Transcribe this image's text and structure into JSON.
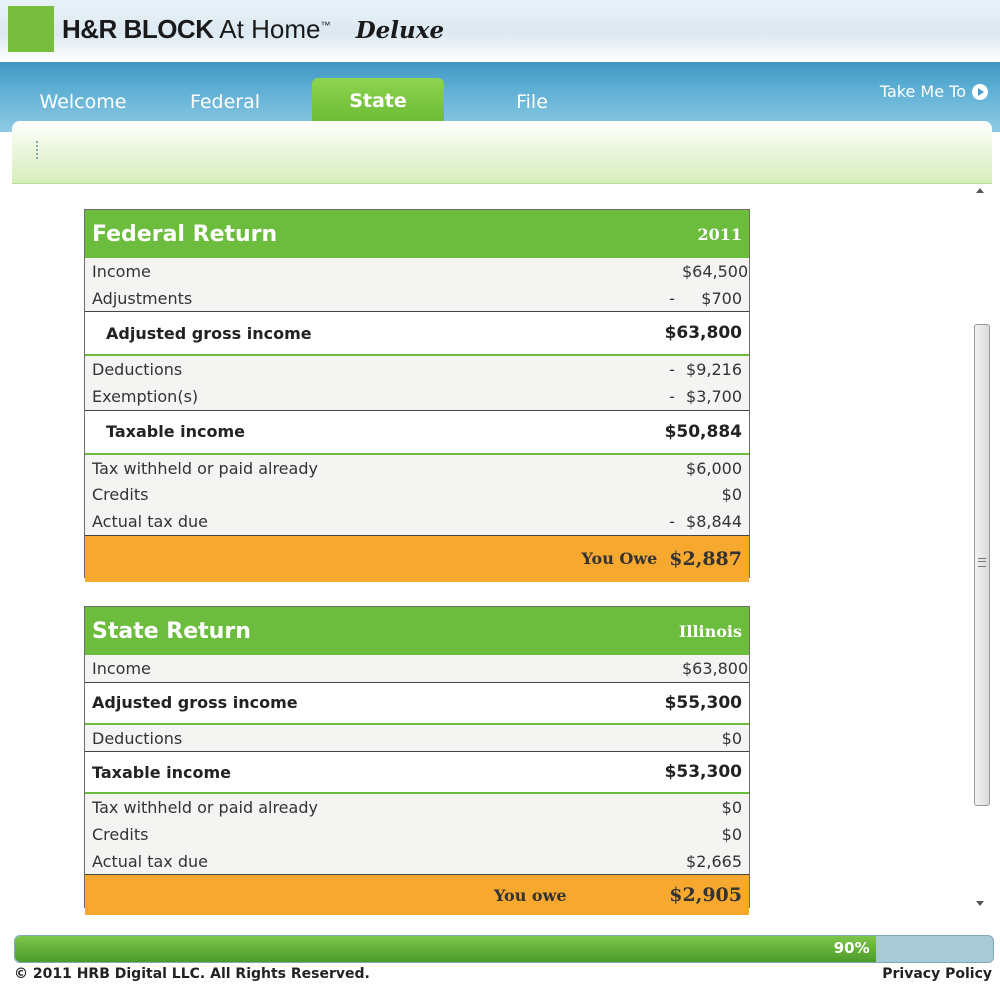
{
  "brand": {
    "name_bold": "H&R BLOCK",
    "name_light": "At Home",
    "tm": "™",
    "product": "Deluxe"
  },
  "nav": {
    "tabs": [
      {
        "label": "Welcome"
      },
      {
        "label": "Federal"
      },
      {
        "label": "State",
        "active": true
      },
      {
        "label": "File"
      }
    ],
    "take_me_to": "Take Me To"
  },
  "federal": {
    "title": "Federal Return",
    "year": "2011",
    "rows": [
      {
        "label": "Income",
        "minus": "",
        "value": "$64,500"
      },
      {
        "label": "Adjustments",
        "minus": "-",
        "value": "$700"
      }
    ],
    "agi": {
      "label": "Adjusted gross income",
      "value": "$63,800"
    },
    "rows2": [
      {
        "label": "Deductions",
        "minus": "-",
        "value": "$9,216"
      },
      {
        "label": "Exemption(s)",
        "minus": "-",
        "value": "$3,700"
      }
    ],
    "taxable": {
      "label": "Taxable income",
      "value": "$50,884"
    },
    "rows3": [
      {
        "label": "Tax withheld or paid already",
        "minus": "",
        "value": "$6,000"
      },
      {
        "label": "Credits",
        "minus": "",
        "value": "$0"
      },
      {
        "label": "Actual tax due",
        "minus": "-",
        "value": "$8,844"
      }
    ],
    "owe": {
      "label": "You Owe",
      "value": "$2,887"
    }
  },
  "state": {
    "title": "State Return",
    "state_name": "Illinois",
    "income": {
      "label": "Income",
      "value": "$63,800"
    },
    "agi": {
      "label": "Adjusted gross income",
      "value": "$55,300"
    },
    "deductions": {
      "label": "Deductions",
      "value": "$0"
    },
    "taxable": {
      "label": "Taxable income",
      "value": "$53,300"
    },
    "rows3": [
      {
        "label": "Tax withheld or paid already",
        "value": "$0"
      },
      {
        "label": "Credits",
        "value": "$0"
      },
      {
        "label": "Actual tax due",
        "value": "$2,665"
      }
    ],
    "owe": {
      "label": "You owe",
      "value": "$2,905"
    }
  },
  "progress": {
    "percent_label": "90%",
    "fraction": 0.88
  },
  "footer": {
    "copyright": "© 2011 HRB Digital LLC. All Rights Reserved.",
    "privacy": "Privacy Policy"
  },
  "colors": {
    "brand_green": "#6cbd3d",
    "owe_orange": "#f6a82f",
    "nav_blue": "#4aa0cc"
  }
}
